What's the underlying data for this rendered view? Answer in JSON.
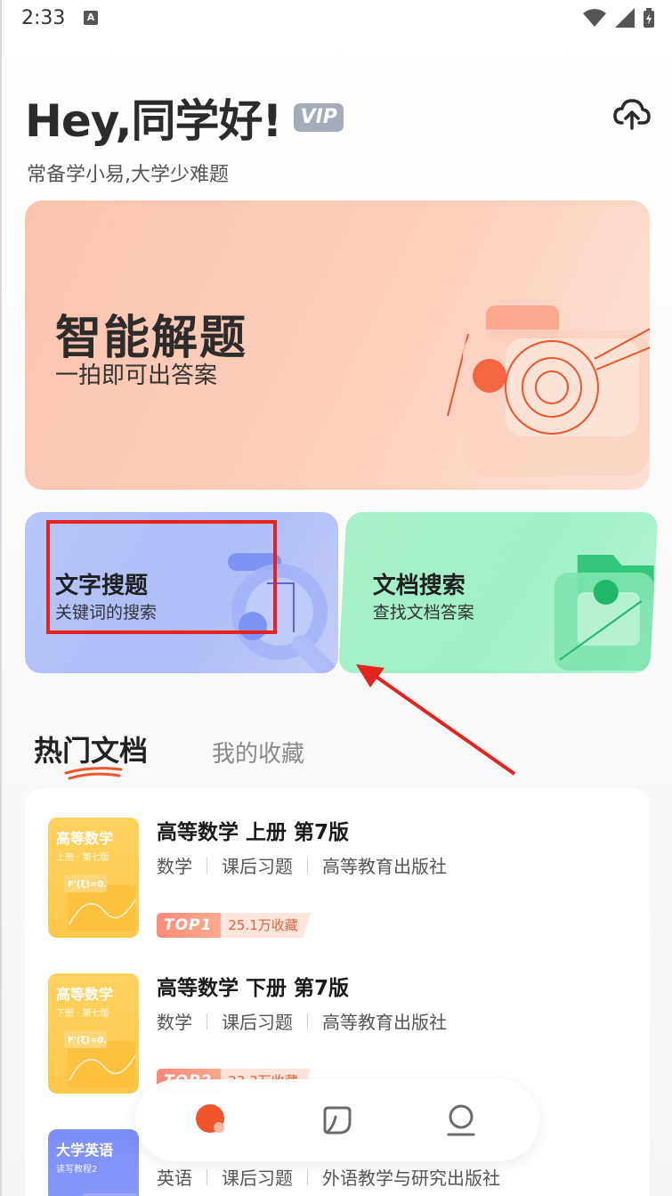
{
  "status_bar": {
    "time": "2:33",
    "badge": "A"
  },
  "header": {
    "greeting": "Hey,同学好!",
    "vip": "VIP",
    "subtitle": "常备学小易,大学少难题",
    "upload_icon": "cloud-upload-icon"
  },
  "hero": {
    "title": "智能解题",
    "subtitle": "一拍即可出答案",
    "icon": "camera-icon"
  },
  "cards": {
    "text_search": {
      "title": "文字搜题",
      "subtitle": "关键词的搜索",
      "icon": "magnifier-icon"
    },
    "doc_search": {
      "title": "文档搜索",
      "subtitle": "查找文档答案",
      "icon": "folder-icon"
    }
  },
  "tabs": {
    "active": "热门文档",
    "inactive": "我的收藏"
  },
  "documents": [
    {
      "cover_title": "高等数学",
      "cover_sub": "上册 · 第七版",
      "cover_formula": "F'(ξ)=0.",
      "title": "高等数学 上册 第7版",
      "tags": [
        "数学",
        "课后习题",
        "高等教育出版社"
      ],
      "rank": "TOP1",
      "favorites": "25.1万收藏"
    },
    {
      "cover_title": "高等数学",
      "cover_sub": "下册 · 第七版",
      "cover_formula": "F'(ξ)=0.",
      "title": "高等数学 下册 第7版",
      "tags": [
        "数学",
        "课后习题",
        "高等教育出版社"
      ],
      "rank": "TOP2",
      "favorites": "23.3万收藏"
    },
    {
      "cover_title": "大学英语",
      "cover_sub": "读写教程2",
      "title": "",
      "tags": [
        "英语",
        "课后习题",
        "外语教学与研究出版社"
      ]
    }
  ],
  "bottom_nav": [
    {
      "name": "home-icon",
      "active": true
    },
    {
      "name": "document-icon",
      "active": false
    },
    {
      "name": "profile-icon",
      "active": false
    }
  ],
  "colors": {
    "accent": "#f0542a",
    "hero_bg": "#fbc3ae",
    "text_card_bg": "#b8c6fa",
    "doc_card_bg": "#a8f0c9",
    "annotation_red": "#e4231e"
  }
}
